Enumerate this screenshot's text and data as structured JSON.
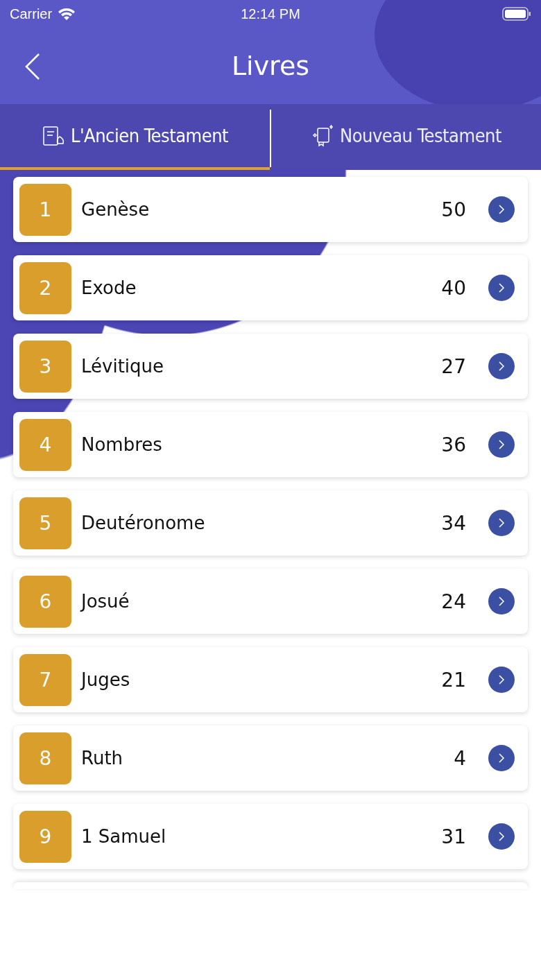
{
  "status_bar": {
    "carrier": "Carrier",
    "time": "12:14 PM"
  },
  "nav": {
    "title": "Livres"
  },
  "tabs": [
    {
      "label": "L'Ancien Testament",
      "selected": true
    },
    {
      "label": "Nouveau Testament",
      "selected": false
    }
  ],
  "books": [
    {
      "number": "1",
      "name": "Genèse",
      "chapters": "50"
    },
    {
      "number": "2",
      "name": "Exode",
      "chapters": "40"
    },
    {
      "number": "3",
      "name": "Lévitique",
      "chapters": "27"
    },
    {
      "number": "4",
      "name": "Nombres",
      "chapters": "36"
    },
    {
      "number": "5",
      "name": "Deutéronome",
      "chapters": "34"
    },
    {
      "number": "6",
      "name": "Josué",
      "chapters": "24"
    },
    {
      "number": "7",
      "name": "Juges",
      "chapters": "21"
    },
    {
      "number": "8",
      "name": "Ruth",
      "chapters": "4"
    },
    {
      "number": "9",
      "name": "1 Samuel",
      "chapters": "31"
    }
  ]
}
